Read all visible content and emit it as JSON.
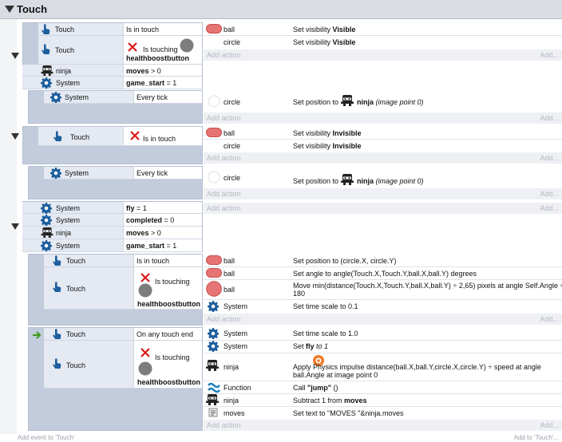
{
  "group": {
    "title": "Touch"
  },
  "footer": {
    "add_event": "Add event to 'Touch'",
    "add_to": "Add to 'Touch'..."
  },
  "common": {
    "add_action": "Add action",
    "add_ellipsis": "Add..."
  },
  "e1": {
    "c1": {
      "obj": "Touch",
      "cond": "Is in touch"
    },
    "c2": {
      "obj": "Touch",
      "cond": "Is touching",
      "param": "healthboostbutton"
    },
    "c3": {
      "obj": "ninja",
      "cond_b": "moves",
      "cond_rest": " > 0"
    },
    "c4": {
      "obj": "System",
      "cond_b": "game_start",
      "cond_rest": " = 1"
    },
    "a1": {
      "obj": "ball",
      "pre": "Set visibility ",
      "b": "Visible"
    },
    "a2": {
      "obj": "circle",
      "pre": "Set visibility ",
      "b": "Visible"
    }
  },
  "e1s": {
    "c1": {
      "obj": "System",
      "cond": "Every tick"
    },
    "a1": {
      "obj": "circle",
      "pre": "Set position to ",
      "b": "ninja",
      "post": " (image point 0)"
    }
  },
  "e2": {
    "c1": {
      "obj": "Touch",
      "cond": "Is in touch"
    },
    "a1": {
      "obj": "ball",
      "pre": "Set visibility ",
      "b": "Invisible"
    },
    "a2": {
      "obj": "circle",
      "pre": "Set visibility ",
      "b": "Invisible"
    }
  },
  "e2s": {
    "c1": {
      "obj": "System",
      "cond": "Every tick"
    },
    "a1": {
      "obj": "circle",
      "pre": "Set position to ",
      "b": "ninja",
      "post": " (image point 0)"
    }
  },
  "e3": {
    "c1": {
      "obj": "System",
      "cond_b": "fly",
      "cond_rest": " = 1"
    },
    "c2": {
      "obj": "System",
      "cond_b": "completed",
      "cond_rest": " = 0"
    },
    "c3": {
      "obj": "ninja",
      "cond_b": "moves",
      "cond_rest": " > 0"
    },
    "c4": {
      "obj": "System",
      "cond_b": "game_start",
      "cond_rest": " = 1"
    }
  },
  "e3a": {
    "c1": {
      "obj": "Touch",
      "cond": "Is in touch"
    },
    "c2": {
      "obj": "Touch",
      "cond": "Is touching",
      "param": "healthboostbutton"
    },
    "a1": {
      "obj": "ball",
      "text": "Set position to (circle.X, circle.Y)"
    },
    "a2": {
      "obj": "ball",
      "text": "Set angle to angle(Touch.X,Touch.Y,ball.X,ball.Y) degrees"
    },
    "a3": {
      "obj": "ball",
      "line1": "Move min(distance(Touch.X,Touch.Y,ball.X,ball.Y) ÷ 2,65) pixels at angle Self.Angle +",
      "line2": "180"
    },
    "a4": {
      "obj": "System",
      "text": "Set time scale to 0.1"
    }
  },
  "e3b": {
    "c1": {
      "obj": "Touch",
      "cond": "On any touch end"
    },
    "c2": {
      "obj": "Touch",
      "cond": "Is touching",
      "param": "healthboostbutton"
    },
    "a1": {
      "obj": "System",
      "text": "Set time scale to 1.0"
    },
    "a2": {
      "obj": "System",
      "pre": "Set ",
      "b": "fly",
      "post": " to 1"
    },
    "a3": {
      "obj": "ninja",
      "line1": "Apply   Physics impulse distance(ball.X,ball.Y,circle.X,circle.Y) ÷ speed at angle",
      "line2": "ball.Angle at image point 0"
    },
    "a4": {
      "obj": "Function",
      "pre": "Call ",
      "b": "\"jump\"",
      "post": " ()"
    },
    "a5": {
      "obj": "ninja",
      "pre": "Subtract 1 from ",
      "b": "moves"
    },
    "a6": {
      "obj": "moves",
      "text": "Set text to \"MOVES \"&ninja.moves"
    }
  },
  "colors": {
    "blue_icon": "#1e5f9e",
    "ball_red": "#e66a6a",
    "red_x": "#dd1111",
    "grey_circle": "#7d7d7d",
    "header_bg": "#d9dce3",
    "cond_obj_bg": "#e4e9f2",
    "event_box": "#c2ccdc"
  }
}
